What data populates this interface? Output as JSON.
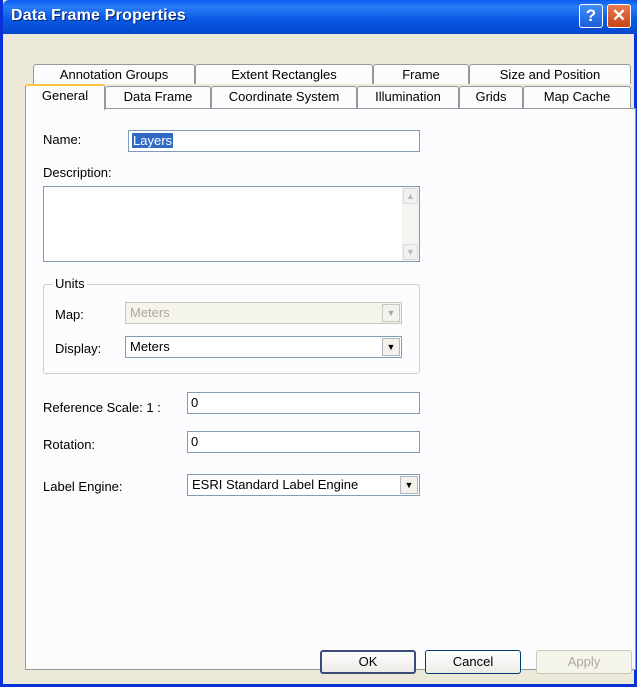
{
  "window": {
    "title": "Data Frame Properties"
  },
  "tabs": {
    "row1": [
      "Annotation Groups",
      "Extent Rectangles",
      "Frame",
      "Size and Position"
    ],
    "row2": [
      "General",
      "Data Frame",
      "Coordinate System",
      "Illumination",
      "Grids",
      "Map Cache"
    ],
    "active": "General"
  },
  "general": {
    "name_label": "Name:",
    "name_value": "Layers",
    "description_label": "Description:",
    "description_value": "",
    "units": {
      "legend": "Units",
      "map_label": "Map:",
      "map_value": "Meters",
      "display_label": "Display:",
      "display_value": "Meters"
    },
    "reference_scale_label": "Reference Scale:  1 :",
    "reference_scale_value": "0",
    "rotation_label": "Rotation:",
    "rotation_value": "0",
    "label_engine_label": "Label Engine:",
    "label_engine_value": "ESRI Standard Label Engine"
  },
  "buttons": {
    "ok": "OK",
    "cancel": "Cancel",
    "apply": "Apply"
  },
  "icons": {
    "help": "help-icon",
    "close": "close-icon"
  },
  "colors": {
    "titlebar": "#0a5ae6",
    "selection": "#316ac5",
    "dialog_bg": "#ece9d8"
  }
}
